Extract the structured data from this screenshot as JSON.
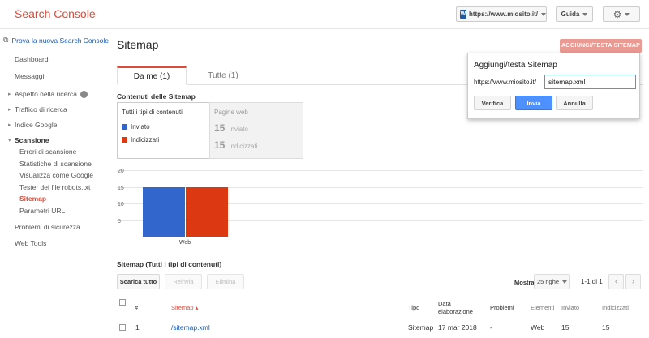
{
  "header": {
    "brand": "Search Console",
    "site": "https://www.miosito.it/",
    "site_favicon": "W",
    "help": "Guida",
    "settings_icon": "gear-icon"
  },
  "sidebar": {
    "new_console": "Prova la nuova Search Console",
    "items": [
      {
        "label": "Dashboard"
      },
      {
        "label": "Messaggi"
      },
      {
        "label": "Aspetto nella ricerca"
      },
      {
        "label": "Traffico di ricerca"
      },
      {
        "label": "Indice Google"
      },
      {
        "label": "Scansione"
      },
      {
        "label": "Problemi di sicurezza"
      },
      {
        "label": "Web Tools"
      }
    ],
    "crawl_sub": [
      "Errori di scansione",
      "Statistiche di scansione",
      "Visualizza come Google",
      "Tester dei file robots.txt",
      "Sitemap",
      "Parametri URL"
    ]
  },
  "main": {
    "title": "Sitemap",
    "add_button": "AGGIUNGI/TESTA SITEMAP",
    "tabs": [
      {
        "label": "Da me (1)"
      },
      {
        "label": "Tutte (1)"
      }
    ],
    "contents_label": "Contenuti delle Sitemap",
    "legend": {
      "title": "Tutti i tipi di contenuti",
      "items": [
        "Inviato",
        "Indicizzati"
      ]
    },
    "stats": {
      "title": "Pagine web",
      "rows": [
        {
          "value": "15",
          "label": "Inviato"
        },
        {
          "value": "15",
          "label": "Indicizzati"
        }
      ]
    }
  },
  "chart_data": {
    "type": "bar",
    "categories": [
      "Web"
    ],
    "series": [
      {
        "name": "Inviato",
        "values": [
          15
        ],
        "color": "#3366cc"
      },
      {
        "name": "Indicizzati",
        "values": [
          15
        ],
        "color": "#dc3912"
      }
    ],
    "yticks": [
      "5",
      "10",
      "15",
      "20"
    ],
    "ylim": [
      0,
      20
    ]
  },
  "table": {
    "title": "Sitemap (Tutti i tipi di contenuti)",
    "buttons": {
      "download": "Scarica tutto",
      "resend": "Reinvia",
      "delete": "Elimina"
    },
    "show_label": "Mostra",
    "rows_select": "25 righe",
    "pager": "1-1 di 1",
    "columns": [
      "#",
      "Sitemap",
      "Tipo",
      "Data elaborazione",
      "Problemi",
      "Elementi",
      "Inviato",
      "Indicizzati"
    ],
    "rows": [
      {
        "num": "1",
        "sitemap": "/sitemap.xml",
        "type": "Sitemap",
        "date": "17 mar 2018",
        "issues": "-",
        "items": "Web",
        "submitted": "15",
        "indexed": "15"
      }
    ]
  },
  "popup": {
    "title": "Aggiungi/testa Sitemap",
    "prefix": "https://www.miosito.it/",
    "input_value": "sitemap.xml",
    "verify": "Verifica",
    "submit": "Invia",
    "cancel": "Annulla"
  }
}
